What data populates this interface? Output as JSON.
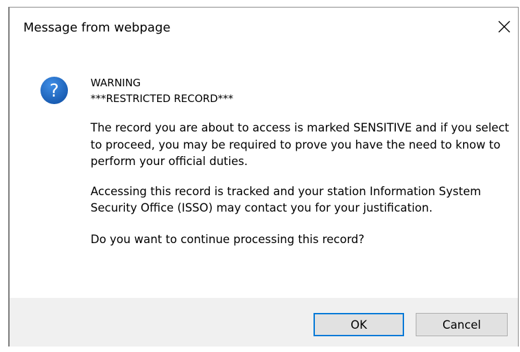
{
  "dialog": {
    "title": "Message from webpage",
    "close_icon": "close-icon",
    "icon": "question-mark-icon",
    "accent_color": "#0078d7",
    "icon_color": "#1c63b8"
  },
  "message": {
    "line1": "WARNING",
    "line2": "***RESTRICTED RECORD***",
    "paragraph1": "The record you are about to access is marked SENSITIVE and if you select to proceed, you may be required to prove you have the need to know to perform your official duties.",
    "paragraph2": "Accessing this record is tracked and your station Information System Security Office (ISSO) may contact you for your justification.",
    "paragraph3": "Do you want to continue processing this record?"
  },
  "buttons": {
    "ok_label": "OK",
    "cancel_label": "Cancel"
  }
}
